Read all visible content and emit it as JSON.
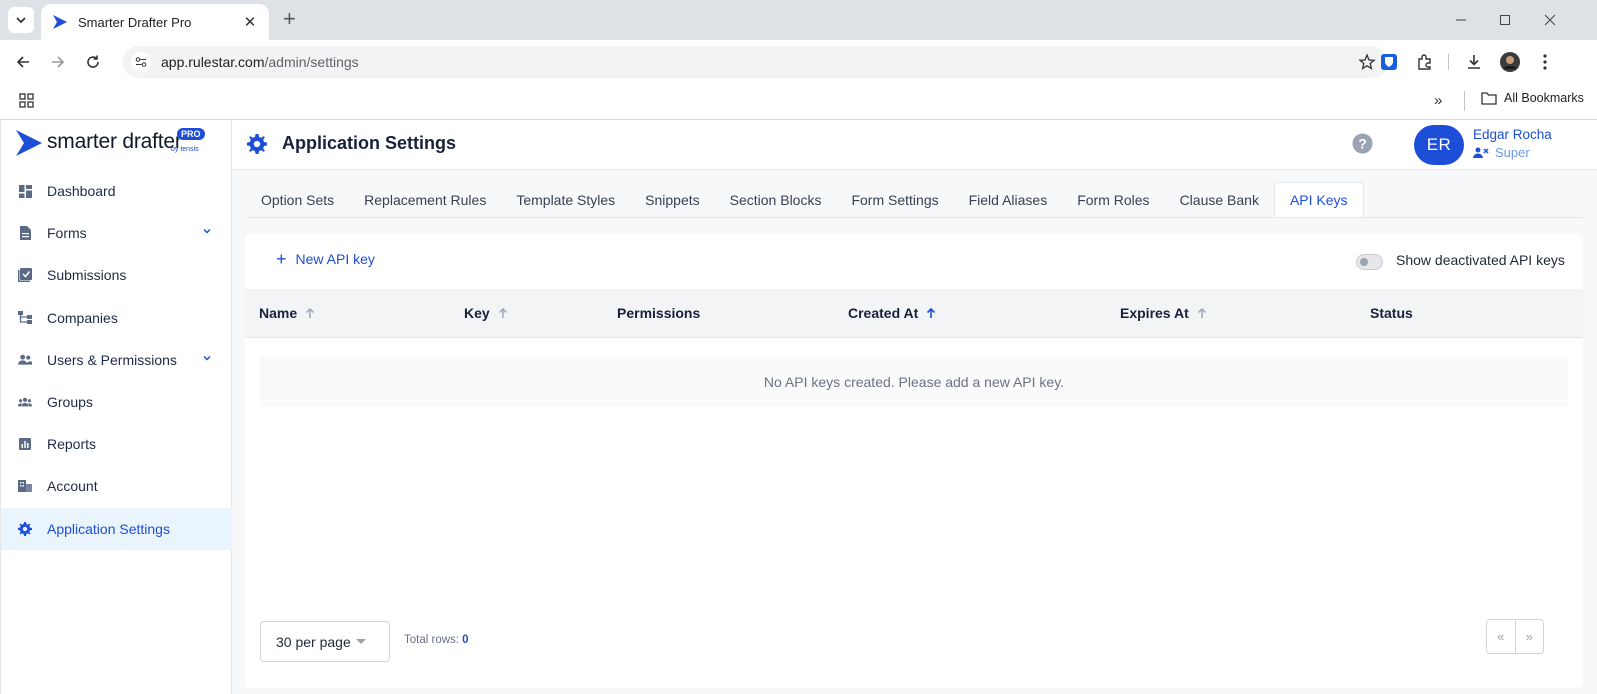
{
  "browser": {
    "tab_title": "Smarter Drafter Pro",
    "url_host": "app.rulestar.com",
    "url_path": "/admin/settings",
    "bookmarks_label": "All Bookmarks"
  },
  "brand": {
    "name": "smarter drafter",
    "badge": "PRO",
    "byline": "by tensis"
  },
  "sidebar": {
    "items": [
      {
        "label": "Dashboard",
        "icon": "dashboard-icon"
      },
      {
        "label": "Forms",
        "icon": "document-icon"
      },
      {
        "label": "Submissions",
        "icon": "submissions-icon"
      },
      {
        "label": "Companies",
        "icon": "companies-icon"
      },
      {
        "label": "Users & Permissions",
        "icon": "users-icon"
      },
      {
        "label": "Groups",
        "icon": "groups-icon"
      },
      {
        "label": "Reports",
        "icon": "reports-icon"
      },
      {
        "label": "Account",
        "icon": "account-icon"
      },
      {
        "label": "Application Settings",
        "icon": "gear-icon"
      }
    ]
  },
  "header": {
    "title": "Application Settings",
    "user_initials": "ER",
    "user_name": "Edgar Rocha",
    "user_role": "Super"
  },
  "tabs": [
    "Option Sets",
    "Replacement Rules",
    "Template Styles",
    "Snippets",
    "Section Blocks",
    "Form Settings",
    "Field Aliases",
    "Form Roles",
    "Clause Bank",
    "API Keys"
  ],
  "api_keys": {
    "new_label": "New API key",
    "toggle_label": "Show deactivated API keys",
    "columns": [
      "Name",
      "Key",
      "Permissions",
      "Created At",
      "Expires At",
      "Status"
    ],
    "empty_message": "No API keys created. Please add a new API key.",
    "per_page": "30 per page",
    "total_rows_label": "Total rows:",
    "total_rows_value": "0",
    "pager_prev": "«",
    "pager_next": "»"
  },
  "colors": {
    "accent": "#1d4ed8",
    "active_bg": "#eaf4fd"
  }
}
